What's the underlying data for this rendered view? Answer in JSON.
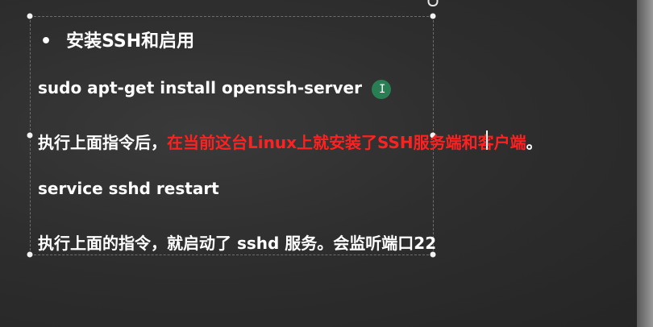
{
  "slide": {
    "heading_bullet": "•",
    "heading": "安装SSH和启用",
    "line1": "sudo apt-get install openssh-server",
    "line2_prefix": "执行上面指令后，",
    "line2_red": "在当前这台Linux上就安装了SSH服务端和客户端",
    "line2_suffix": "。",
    "line3": "service sshd restart",
    "line4": "执行上面的指令，就启动了 sshd 服务。会监听端口22"
  },
  "colors": {
    "background": "#2b2b2b",
    "text": "#ffffff",
    "highlight": "#ff2020",
    "cursor_halo": "#288c5a"
  },
  "icons": {
    "mouse_cursor": "i-beam-cursor-icon",
    "rotate_handle": "rotate-handle-icon"
  }
}
